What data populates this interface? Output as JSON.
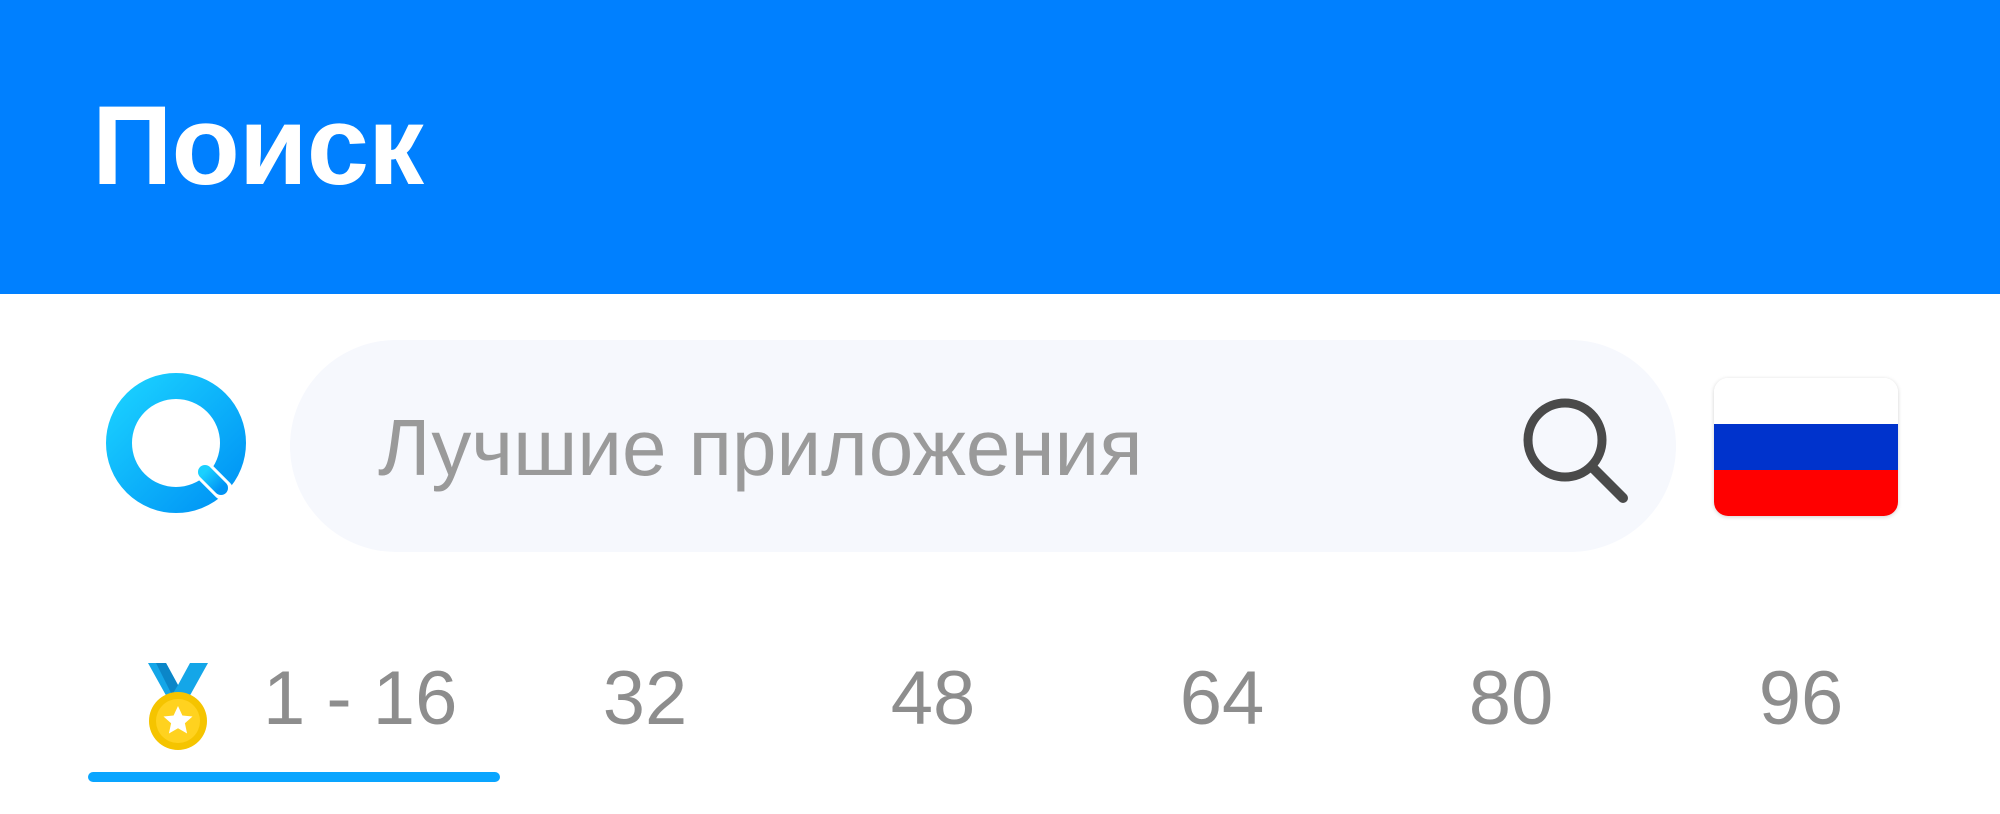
{
  "header": {
    "title": "Поиск",
    "background_color": "#0080ff"
  },
  "search": {
    "logo_icon": "app-search-logo-icon",
    "placeholder": "Лучшие приложения",
    "search_icon": "magnifier-icon",
    "region_flag": "russia-flag-icon"
  },
  "tabs": {
    "items": [
      {
        "label": "1 - 16",
        "icon": "medal-icon",
        "active": true
      },
      {
        "label": "32",
        "active": false
      },
      {
        "label": "48",
        "active": false
      },
      {
        "label": "64",
        "active": false
      },
      {
        "label": "80",
        "active": false
      },
      {
        "label": "96",
        "active": false
      }
    ],
    "active_color": "#0aa5ff",
    "inactive_text_color": "#8d8d8d"
  }
}
